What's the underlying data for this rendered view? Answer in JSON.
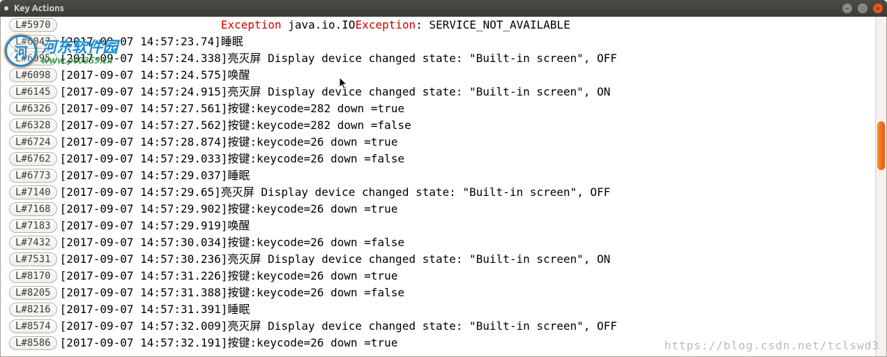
{
  "window": {
    "title": "Key Actions"
  },
  "watermark_logo": {
    "circle": "河",
    "text": "河东软件园",
    "url": "www.pc0359.cn"
  },
  "watermark_br": "https://blog.csdn.net/tclswd3",
  "rows": [
    {
      "line": "L#5970",
      "text": "                        Exception java.io.IOException: SERVICE_NOT_AVAILABLE"
    },
    {
      "line": "L#6047",
      "text": "[2017-09-07 14:57:23.74]睡眠"
    },
    {
      "line": "L#6095",
      "text": "[2017-09-07 14:57:24.338]亮灭屏 Display device changed state: \"Built-in screen\", OFF"
    },
    {
      "line": "L#6098",
      "text": "[2017-09-07 14:57:24.575]唤醒"
    },
    {
      "line": "L#6145",
      "text": "[2017-09-07 14:57:24.915]亮灭屏 Display device changed state: \"Built-in screen\", ON"
    },
    {
      "line": "L#6326",
      "text": "[2017-09-07 14:57:27.561]按键:keycode=282 down =true"
    },
    {
      "line": "L#6328",
      "text": "[2017-09-07 14:57:27.562]按键:keycode=282 down =false"
    },
    {
      "line": "L#6724",
      "text": "[2017-09-07 14:57:28.874]按键:keycode=26 down =true"
    },
    {
      "line": "L#6762",
      "text": "[2017-09-07 14:57:29.033]按键:keycode=26 down =false"
    },
    {
      "line": "L#6773",
      "text": "[2017-09-07 14:57:29.037]睡眠"
    },
    {
      "line": "L#7140",
      "text": "[2017-09-07 14:57:29.65]亮灭屏 Display device changed state: \"Built-in screen\", OFF"
    },
    {
      "line": "L#7168",
      "text": "[2017-09-07 14:57:29.902]按键:keycode=26 down =true"
    },
    {
      "line": "L#7183",
      "text": "[2017-09-07 14:57:29.919]唤醒"
    },
    {
      "line": "L#7432",
      "text": "[2017-09-07 14:57:30.034]按键:keycode=26 down =false"
    },
    {
      "line": "L#7531",
      "text": "[2017-09-07 14:57:30.236]亮灭屏 Display device changed state: \"Built-in screen\", ON"
    },
    {
      "line": "L#8170",
      "text": "[2017-09-07 14:57:31.226]按键:keycode=26 down =true"
    },
    {
      "line": "L#8205",
      "text": "[2017-09-07 14:57:31.388]按键:keycode=26 down =false"
    },
    {
      "line": "L#8216",
      "text": "[2017-09-07 14:57:31.391]睡眠"
    },
    {
      "line": "L#8574",
      "text": "[2017-09-07 14:57:32.009]亮灭屏 Display device changed state: \"Built-in screen\", OFF"
    },
    {
      "line": "L#8586",
      "text": "[2017-09-07 14:57:32.191]按键:keycode=26 down =true"
    }
  ]
}
